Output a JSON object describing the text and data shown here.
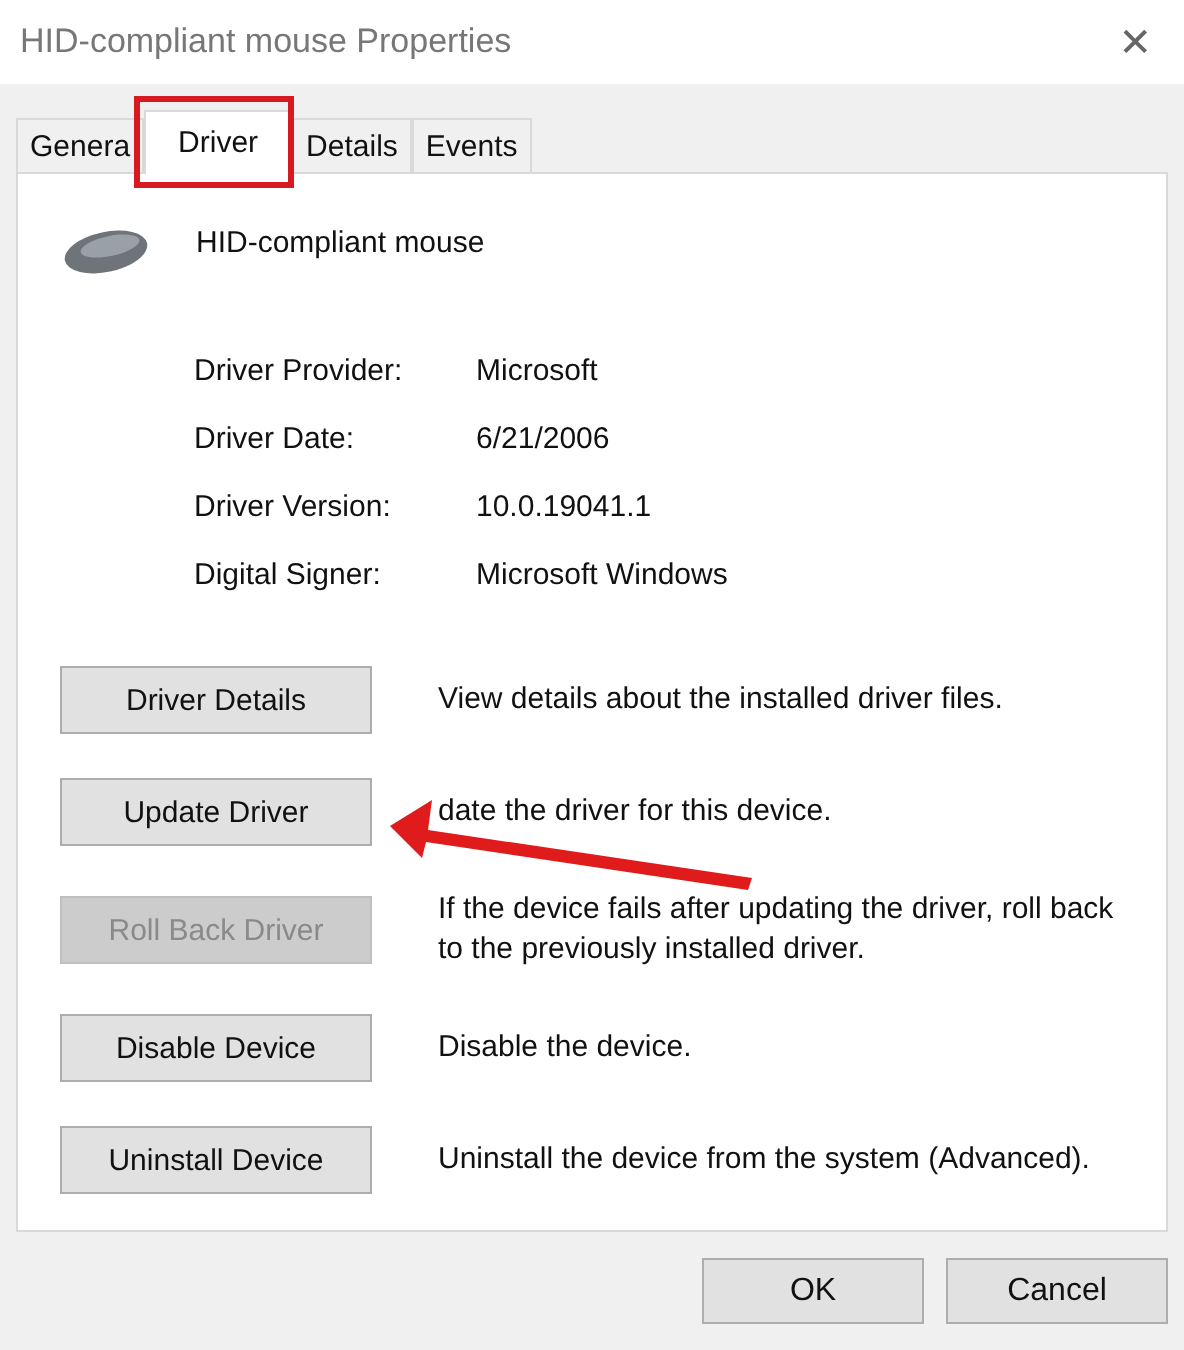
{
  "window": {
    "title": "HID-compliant mouse Properties",
    "close": "✕"
  },
  "tabs": [
    {
      "label": "Genera",
      "selected": false
    },
    {
      "label": "Driver",
      "selected": true
    },
    {
      "label": "Details",
      "selected": false
    },
    {
      "label": "Events",
      "selected": false
    }
  ],
  "device": {
    "name": "HID-compliant mouse"
  },
  "properties": [
    {
      "label": "Driver Provider:",
      "value": "Microsoft"
    },
    {
      "label": "Driver Date:",
      "value": "6/21/2006"
    },
    {
      "label": "Driver Version:",
      "value": "10.0.19041.1"
    },
    {
      "label": "Digital Signer:",
      "value": "Microsoft Windows"
    }
  ],
  "actions": [
    {
      "label": "Driver Details",
      "description": "View details about the installed driver files.",
      "disabled": false
    },
    {
      "label": "Update Driver",
      "description": "date the driver for this device.",
      "disabled": false
    },
    {
      "label": "Roll Back Driver",
      "description": "If the device fails after updating the driver, roll back to the previously installed driver.",
      "disabled": true
    },
    {
      "label": "Disable Device",
      "description": "Disable the device.",
      "disabled": false
    },
    {
      "label": "Uninstall Device",
      "description": "Uninstall the device from the system (Advanced).",
      "disabled": false
    }
  ],
  "buttons": [
    "OK",
    "Cancel"
  ]
}
